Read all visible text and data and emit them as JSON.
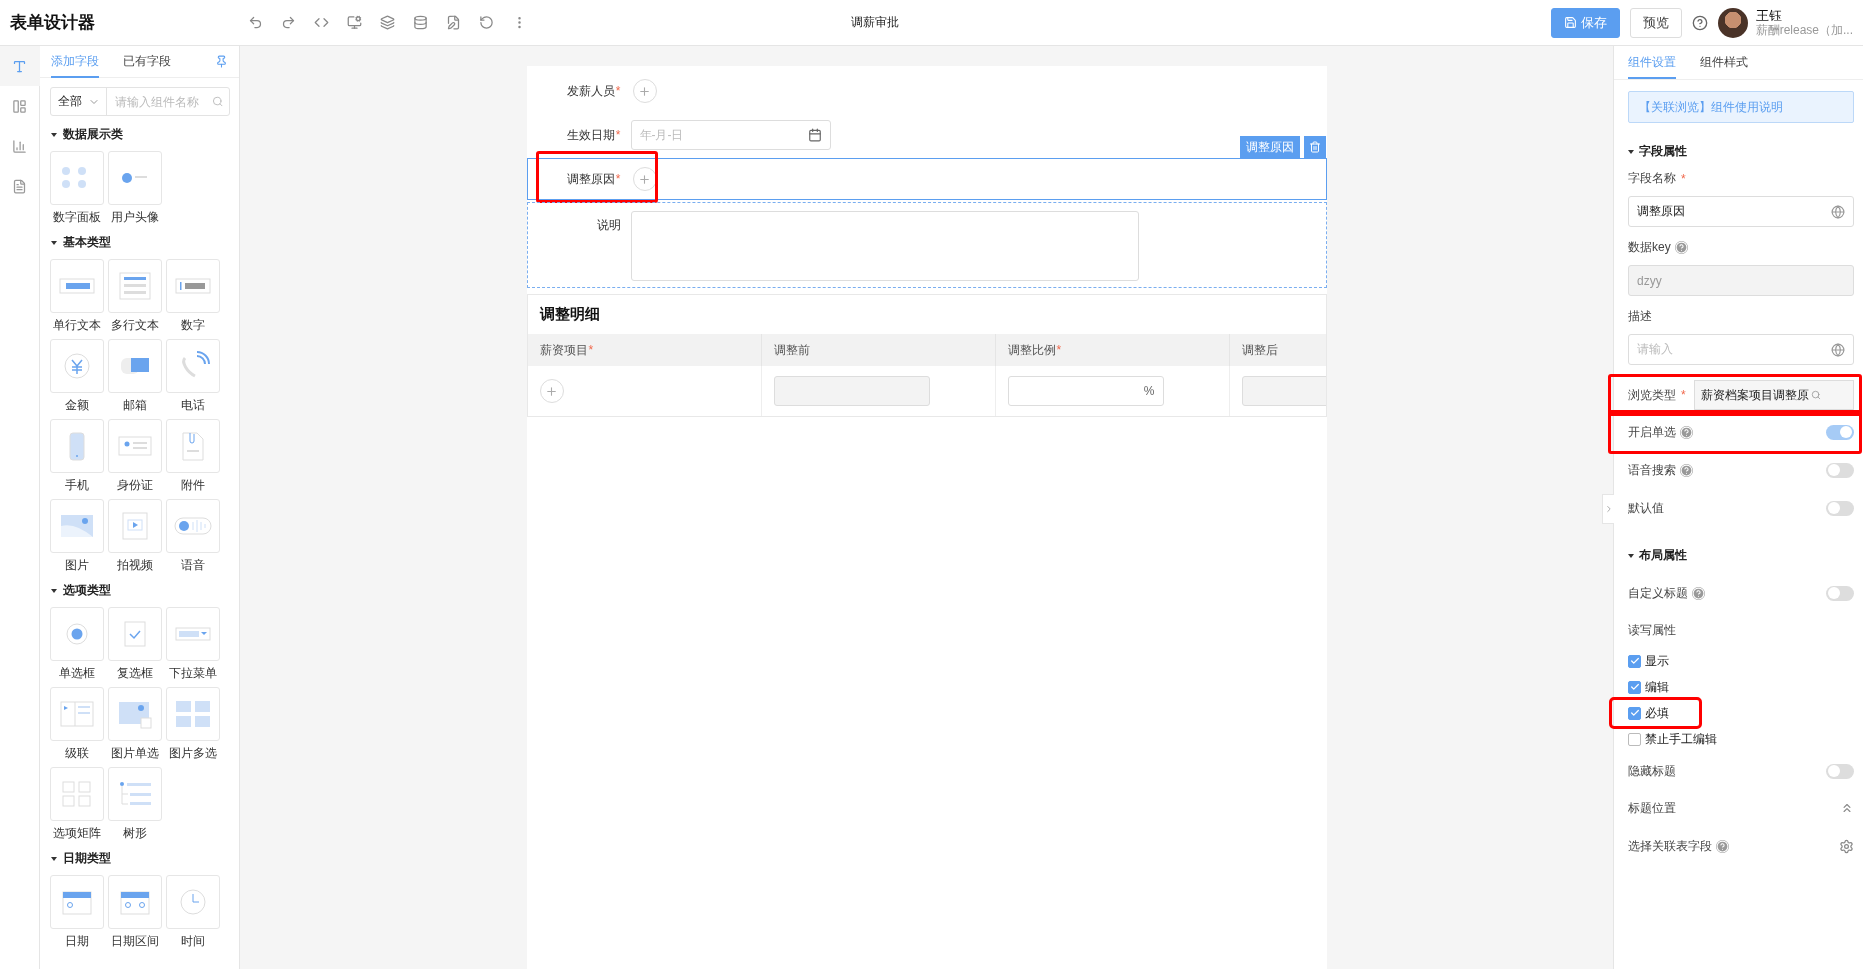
{
  "app_title": "表单设计器",
  "page_title": "调薪审批",
  "header_buttons": [
    {
      "label": "保存",
      "kind": "primary"
    },
    {
      "label": "预览",
      "kind": "default"
    }
  ],
  "user": {
    "name": "王钰",
    "subtitle": "薪酬release（加..."
  },
  "side_rail": [
    {
      "selected": true
    },
    {
      "selected": false
    },
    {
      "selected": false
    },
    {
      "selected": false
    }
  ],
  "panel_tabs": [
    {
      "label": "添加字段",
      "selected": true
    },
    {
      "label": "已有字段",
      "selected": false
    }
  ],
  "filter": {
    "value": "全部",
    "placeholder": "请输入组件名称"
  },
  "groups": [
    {
      "title": "数据展示类",
      "items": [
        "数字面板",
        "用户头像"
      ]
    },
    {
      "title": "基本类型",
      "items": [
        "单行文本",
        "多行文本",
        "数字",
        "金额",
        "邮箱",
        "电话",
        "手机",
        "身份证",
        "附件",
        "图片",
        "拍视频",
        "语音"
      ]
    },
    {
      "title": "选项类型",
      "items": [
        "单选框",
        "复选框",
        "下拉菜单",
        "级联",
        "图片单选",
        "图片多选",
        "选项矩阵",
        "树形"
      ]
    },
    {
      "title": "日期类型",
      "items": [
        "日期",
        "日期区间",
        "时间"
      ]
    }
  ],
  "form_fields": [
    {
      "label": "发薪人员",
      "required_mark": "*",
      "kind": "picker",
      "selected": false,
      "highlighted": false
    },
    {
      "label": "生效日期",
      "required_mark": "*",
      "kind": "date",
      "placeholder": "年-月-日",
      "selected": false,
      "highlighted": false
    },
    {
      "label": "调整原因",
      "required_mark": "*",
      "kind": "picker",
      "selected": true,
      "tag": "调整原因",
      "highlighted": true
    },
    {
      "label": "说明",
      "kind": "textarea",
      "selected": false,
      "highlighted": false
    }
  ],
  "detail_table": {
    "title": "调整明细",
    "columns": [
      {
        "label": "薪资项目",
        "required_mark": "*",
        "kind": "picker"
      },
      {
        "label": "调整前",
        "kind": "disabled"
      },
      {
        "label": "调整比例",
        "required_mark": "*",
        "kind": "percent",
        "suffix": "%"
      },
      {
        "label": "调整后",
        "kind": "disabled"
      }
    ]
  },
  "settings_tabs": [
    {
      "label": "组件设置",
      "selected": true
    },
    {
      "label": "组件样式",
      "selected": false
    }
  ],
  "help_link": "【关联浏览】组件使用说明",
  "sections": [
    {
      "title": "字段属性",
      "rows": [
        {
          "kind": "input",
          "label": "字段名称",
          "required_mark": "*",
          "value": "调整原因",
          "highlighted": false
        },
        {
          "kind": "readonly",
          "label": "数据key",
          "help": true,
          "value": "dzyy",
          "highlighted": false
        },
        {
          "kind": "input",
          "label": "描述",
          "placeholder": "请输入",
          "highlighted": false
        },
        {
          "kind": "browse",
          "label": "浏览类型",
          "required_mark": "*",
          "value": "薪资档案项目调整原",
          "highlighted": true
        },
        {
          "kind": "switch",
          "label": "开启单选",
          "help": true,
          "on": true,
          "highlighted": true
        },
        {
          "kind": "switch",
          "label": "语音搜索",
          "help": true,
          "on": false,
          "highlighted": false
        },
        {
          "kind": "switch",
          "label": "默认值",
          "help": false,
          "on": false,
          "highlighted": false
        }
      ]
    },
    {
      "title": "布局属性",
      "rows": [
        {
          "kind": "switch",
          "label": "自定义标题",
          "help": true,
          "on": false,
          "highlighted": false
        },
        {
          "kind": "label",
          "label": "读写属性",
          "highlighted": false
        },
        {
          "kind": "checkbox",
          "label": "显示",
          "checked": true,
          "highlighted": false
        },
        {
          "kind": "checkbox",
          "label": "编辑",
          "checked": true,
          "highlighted": false
        },
        {
          "kind": "checkbox",
          "label": "必填",
          "checked": true,
          "highlighted": true
        },
        {
          "kind": "checkbox",
          "label": "禁止手工编辑",
          "checked": false,
          "highlighted": false
        },
        {
          "kind": "switch",
          "label": "隐藏标题",
          "help": false,
          "on": false,
          "highlighted": false
        },
        {
          "kind": "collapse",
          "label": "标题位置",
          "highlighted": false
        },
        {
          "kind": "gear",
          "label": "选择关联表字段",
          "help": true,
          "highlighted": false
        }
      ]
    }
  ]
}
